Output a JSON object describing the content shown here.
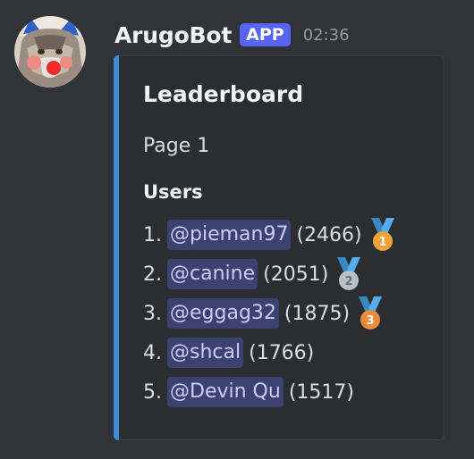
{
  "author": {
    "name": "ArugoBot",
    "badge": "APP",
    "timestamp": "02:36",
    "avatar_icon": "wolf-avatar-icon"
  },
  "embed": {
    "accent_color": "#3c8bd9",
    "title": "Leaderboard",
    "page_label": "Page 1",
    "section_title": "Users",
    "rows": [
      {
        "rank": "1.",
        "user": "@pieman97",
        "score": "(2466)",
        "medal": "gold",
        "medal_number": "1"
      },
      {
        "rank": "2.",
        "user": "@canine",
        "score": "(2051)",
        "medal": "silver",
        "medal_number": "2"
      },
      {
        "rank": "3.",
        "user": "@eggag32",
        "score": "(1875)",
        "medal": "bronze",
        "medal_number": "3"
      },
      {
        "rank": "4.",
        "user": "@shcal",
        "score": "(1766)",
        "medal": null,
        "medal_number": null
      },
      {
        "rank": "5.",
        "user": "@Devin Qu",
        "score": "(1517)",
        "medal": null,
        "medal_number": null
      }
    ]
  },
  "colors": {
    "background": "#313338",
    "embed_background": "#2b2d31",
    "badge": "#5865f2",
    "mention_background": "#3c4270",
    "mention_text": "#c9cdfb",
    "gold": "#f0a43a",
    "silver": "#b9c0c8",
    "bronze": "#ee8c3c"
  }
}
